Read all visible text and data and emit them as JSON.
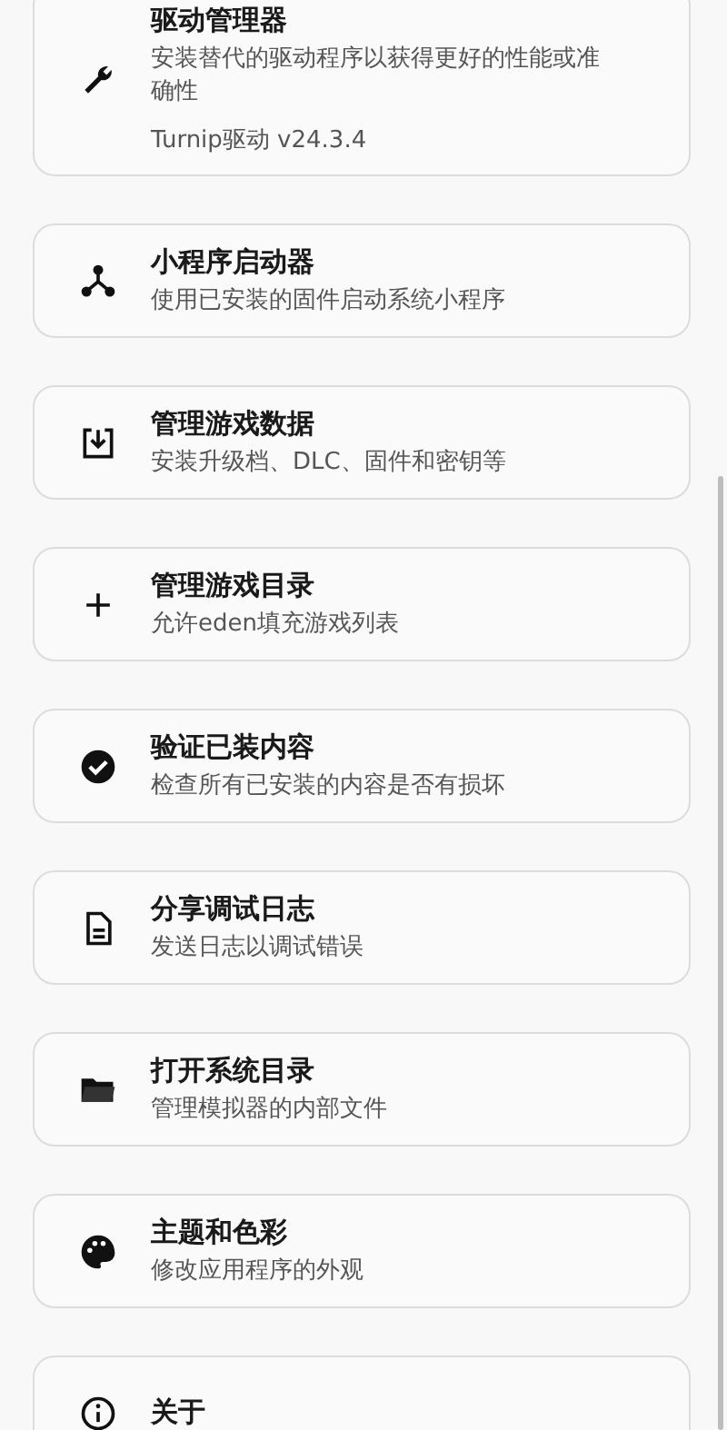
{
  "settings_items": [
    {
      "title": "驱动管理器",
      "description": "安装替代的驱动程序以获得更好的性能或准确性",
      "detail": "Turnip驱动  v24.3.4"
    },
    {
      "title": "小程序启动器",
      "description": "使用已安装的固件启动系统小程序"
    },
    {
      "title": "管理游戏数据",
      "description": "安装升级档、DLC、固件和密钥等"
    },
    {
      "title": "管理游戏目录",
      "description": "允许eden填充游戏列表"
    },
    {
      "title": "验证已装内容",
      "description": "检查所有已安装的内容是否有损坏"
    },
    {
      "title": "分享调试日志",
      "description": "发送日志以调试错误"
    },
    {
      "title": "打开系统目录",
      "description": "管理模拟器的内部文件"
    },
    {
      "title": "主题和色彩",
      "description": "修改应用程序的外观"
    },
    {
      "title": "关于"
    }
  ]
}
